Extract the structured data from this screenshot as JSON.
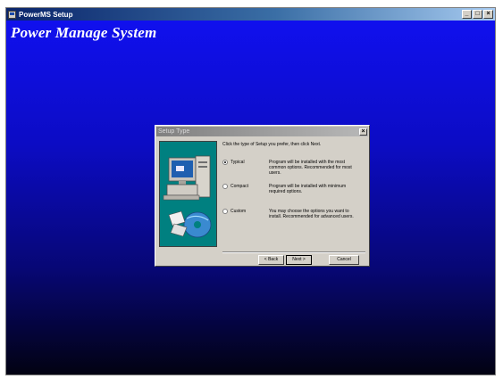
{
  "window": {
    "title": "PowerMS Setup",
    "controls": {
      "minimize": "_",
      "maximize": "□",
      "close": "×"
    }
  },
  "brand": "Power Manage System",
  "dialog": {
    "title": "Setup Type",
    "close": "×",
    "prompt": "Click the type of Setup you prefer, then click Next.",
    "options": [
      {
        "label": "Typical",
        "checked": true,
        "description": "Program will be installed with the most common options.  Recommended for most users."
      },
      {
        "label": "Compact",
        "checked": false,
        "description": "Program will be installed with minimum required options."
      },
      {
        "label": "Custom",
        "checked": false,
        "description": "You may choose the options you want to install. Recommended for advanced users."
      }
    ],
    "buttons": {
      "back": "< Back",
      "next": "Next >",
      "cancel": "Cancel"
    }
  },
  "colors": {
    "desktop_top": "#1010ee",
    "desktop_bottom": "#020212",
    "illustration_bg": "#008080"
  }
}
